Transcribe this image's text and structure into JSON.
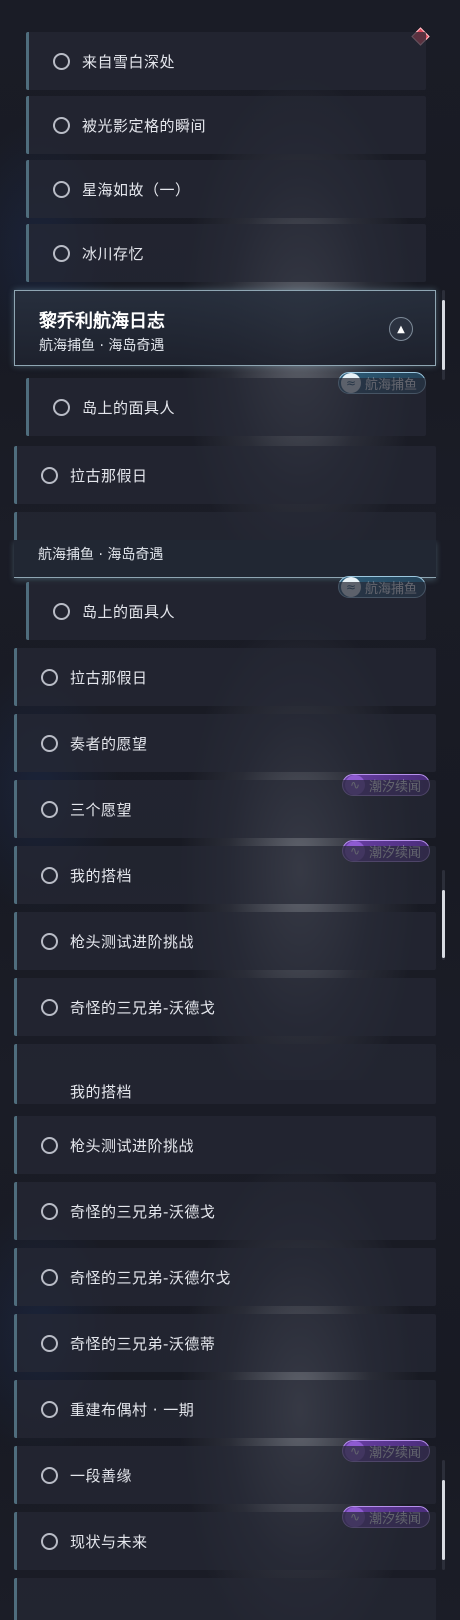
{
  "section1": {
    "items": [
      "来自雪白深处",
      "被光影定格的瞬间",
      "星海如故（一）",
      "冰川存忆"
    ],
    "header_title": "黎乔利航海日志",
    "header_subtitle": "航海捕鱼 · 海岛奇遇",
    "header_badge": "航海捕鱼",
    "sub_item": "岛上的面具人",
    "main_item": "拉古那假日"
  },
  "section2": {
    "header_subtitle": "航海捕鱼 · 海岛奇遇",
    "header_badge": "航海捕鱼",
    "sub_item": "岛上的面具人",
    "items": [
      "拉古那假日",
      "奏者的愿望",
      "三个愿望",
      "我的搭档",
      "枪头测试进阶挑战",
      "奇怪的三兄弟-沃德戈"
    ],
    "badges": [
      "潮汐续闻",
      "潮汐续闻"
    ]
  },
  "section3": {
    "cut_top": "我的搭档",
    "items": [
      "枪头测试进阶挑战",
      "奇怪的三兄弟-沃德戈",
      "奇怪的三兄弟-沃德尔戈",
      "奇怪的三兄弟-沃德蒂",
      "重建布偶村 · 一期",
      "一段善缘",
      "现状与未来"
    ],
    "badges": [
      "潮汐续闻",
      "潮汐续闻"
    ]
  },
  "colors": {
    "accent_purple": "#6a3fa6",
    "accent_teal": "#2d5c78",
    "row_border": "#4f6d7d",
    "alert_red": "#e04a5b"
  },
  "icons": [
    "circle-status-icon",
    "chevron-up-icon",
    "alert-diamond-icon",
    "badge-wave-icon"
  ]
}
